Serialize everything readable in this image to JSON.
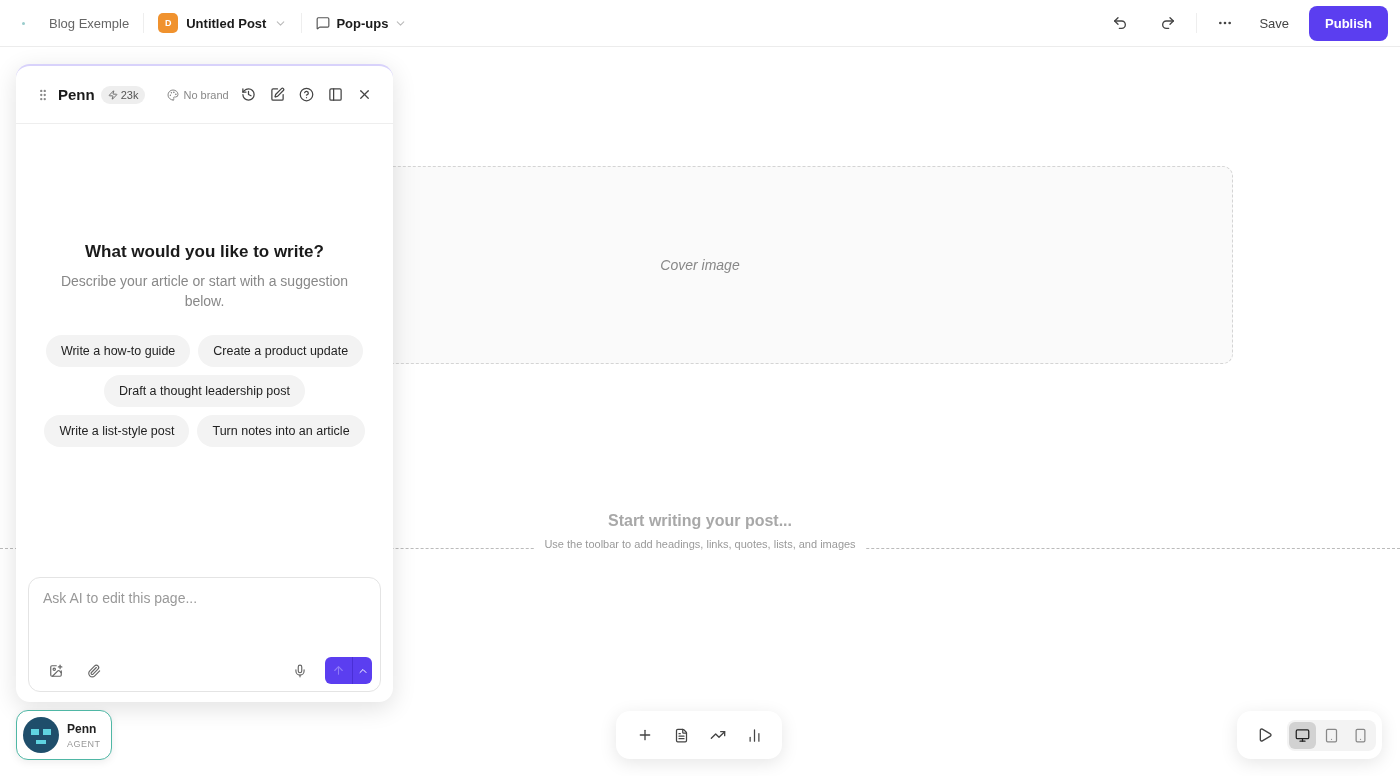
{
  "topbar": {
    "site": "Blog Exemple",
    "post": {
      "initial": "D",
      "title": "Untitled Post"
    },
    "popups": "Pop-ups",
    "save": "Save",
    "publish": "Publish"
  },
  "assistant": {
    "name": "Penn",
    "credits": "23k",
    "brand": "No brand",
    "heading": "What would you like to write?",
    "subtext": "Describe your article or start with a suggestion below.",
    "suggestion_rows": [
      [
        "Write a how-to guide",
        "Create a product update"
      ],
      [
        "Draft a thought leadership post"
      ],
      [
        "Write a list-style post",
        "Turn notes into an article"
      ]
    ],
    "composer": {
      "placeholder": "Ask AI to edit this page..."
    }
  },
  "agent": {
    "name": "Penn",
    "role": "AGENT"
  },
  "editor": {
    "cover": "Cover image",
    "title_placeholder": "Start writing your post...",
    "hint": "Use the toolbar to add headings, links, quotes, lists, and images"
  },
  "view_modes": [
    {
      "kind": "desktop",
      "selected": true
    },
    {
      "kind": "tablet",
      "selected": false
    },
    {
      "kind": "phone",
      "selected": false
    }
  ]
}
